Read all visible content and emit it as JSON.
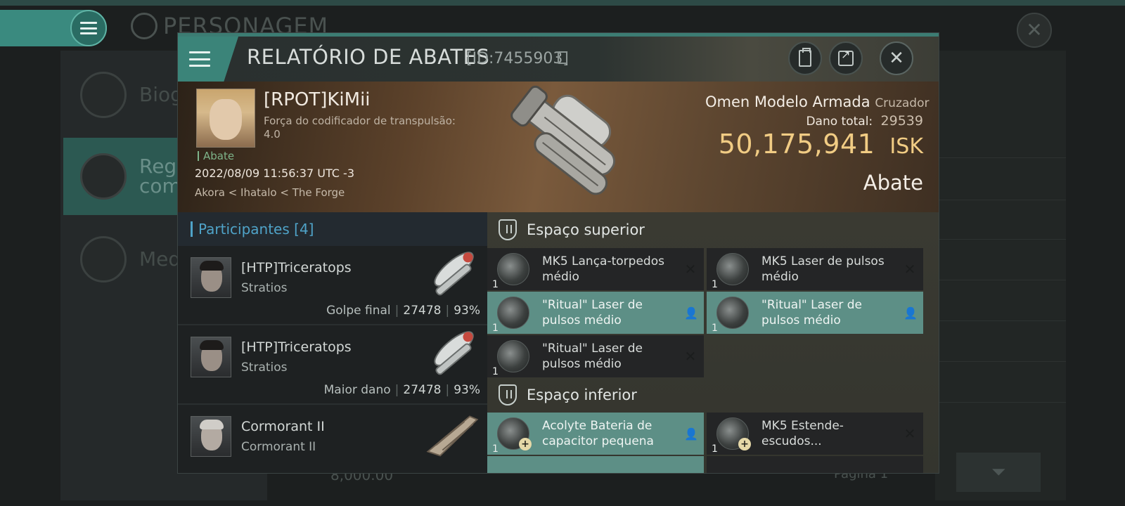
{
  "background": {
    "screen_title": "PERSONAGEM",
    "sidebar": [
      "Biog",
      "Regi com",
      "Meda"
    ],
    "page_label": "Página 1",
    "isk_hint": "8,000.00"
  },
  "dialog": {
    "title": "RELATÓRIO DE ABATES",
    "report_id": "[ID:7455903]",
    "victim": {
      "name": "[RPOT]KiMii",
      "subtitle": "Força do codificador de transpulsão: 4.0",
      "tag": "Abate",
      "datetime": "2022/08/09 11:56:37 UTC -3",
      "location": "Akora < Ihatalo < The Forge"
    },
    "ship": {
      "name": "Omen Modelo Armada",
      "class": "Cruzador",
      "damage_label": "Dano total:",
      "damage_value": "29539",
      "isk_value": "50,175,941",
      "isk_currency": "ISK",
      "outcome": "Abate"
    },
    "participants": {
      "header": "Participantes [4]",
      "rows": [
        {
          "name": "[HTP]Triceratops",
          "ship": "Stratios",
          "label": "Golpe final",
          "damage": "27478",
          "percent": "93%"
        },
        {
          "name": "[HTP]Triceratops",
          "ship": "Stratios",
          "label": "Maior dano",
          "damage": "27478",
          "percent": "93%"
        },
        {
          "name": "Cormorant II",
          "ship": "Cormorant II"
        }
      ]
    },
    "sections": {
      "high": {
        "title": "Espaço superior",
        "items": [
          {
            "name": "MK5 Lança-torpedos médio",
            "qty": "1",
            "dropped": false
          },
          {
            "name": "MK5 Laser de pulsos médio",
            "qty": "1",
            "dropped": false
          },
          {
            "name": "\"Ritual\"  Laser de pulsos médio",
            "qty": "1",
            "dropped": true
          },
          {
            "name": "\"Ritual\"  Laser de pulsos médio",
            "qty": "1",
            "dropped": true
          },
          {
            "name": "\"Ritual\"  Laser de pulsos médio",
            "qty": "1",
            "dropped": false
          }
        ]
      },
      "low": {
        "title": "Espaço inferior",
        "items": [
          {
            "name": "Acolyte Bateria de capacitor pequena",
            "qty": "1",
            "dropped": true
          },
          {
            "name": "MK5 Estende-escudos...",
            "qty": "1",
            "dropped": false
          }
        ]
      }
    },
    "colors": {
      "accent": "#3b8479",
      "isk": "#f1cc84",
      "participants": "#4fa3c8",
      "dropped_item": "#5d8f86"
    }
  }
}
